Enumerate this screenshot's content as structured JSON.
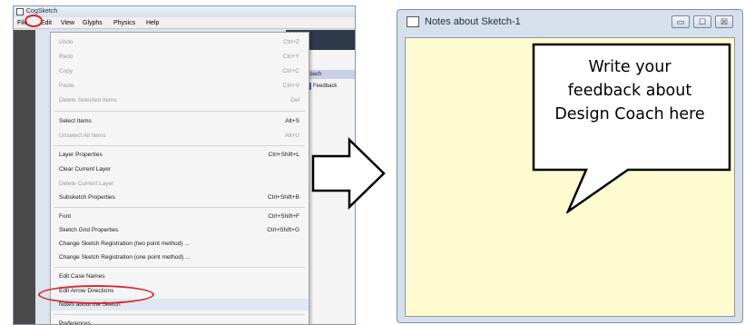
{
  "left_window": {
    "title": "CogSketch",
    "menubar": [
      "File",
      "Edit",
      "View",
      "Glyphs",
      "Physics",
      "Help"
    ],
    "coach_tab": "Coach",
    "feedback_button": "Feedback",
    "edit_menu": [
      {
        "label": "Undo",
        "shortcut": "Ctrl+Z",
        "enabled": false
      },
      {
        "label": "Redo",
        "shortcut": "Ctrl+Y",
        "enabled": false
      },
      {
        "label": "Copy",
        "shortcut": "Ctrl+C",
        "enabled": false
      },
      {
        "label": "Paste",
        "shortcut": "Ctrl+V",
        "enabled": false
      },
      {
        "label": "Delete Selected Items",
        "shortcut": "Del",
        "enabled": false
      },
      {
        "label": "Select Items",
        "shortcut": "Alt+S",
        "enabled": true
      },
      {
        "label": "Unselect All Items",
        "shortcut": "Alt+U",
        "enabled": false
      },
      {
        "label": "Layer Properties",
        "shortcut": "Ctrl+Shift+L",
        "enabled": true
      },
      {
        "label": "Clear Current Layer",
        "shortcut": "",
        "enabled": true
      },
      {
        "label": "Delete Current Layer",
        "shortcut": "",
        "enabled": false
      },
      {
        "label": "Subsketch Properties",
        "shortcut": "Ctrl+Shift+B",
        "enabled": true
      },
      {
        "label": "Font",
        "shortcut": "Ctrl+Shift+F",
        "enabled": true
      },
      {
        "label": "Sketch Grid Properties",
        "shortcut": "Ctrl+Shift+G",
        "enabled": true
      },
      {
        "label": "Change Sketch Registration (two point method) ...",
        "shortcut": "",
        "enabled": true
      },
      {
        "label": "Change Sketch Registration (one point method) ...",
        "shortcut": "",
        "enabled": true
      },
      {
        "label": "Edit Case Names",
        "shortcut": "",
        "enabled": true
      },
      {
        "label": "Edit Arrow Directions",
        "shortcut": "",
        "enabled": true
      },
      {
        "label": "Notes about the Sketch",
        "shortcut": "",
        "enabled": true
      },
      {
        "label": "Preferences",
        "shortcut": "",
        "enabled": true
      }
    ]
  },
  "right_window": {
    "title": "Notes about Sketch-1",
    "buttons": {
      "minimize": "▭",
      "maximize": "☐",
      "close": "☒"
    },
    "callout_lines": [
      "Write your",
      "feedback about",
      "Design Coach here"
    ]
  },
  "colors": {
    "highlight_circle": "#d9262c",
    "notes_background": "#fdfbd0"
  }
}
